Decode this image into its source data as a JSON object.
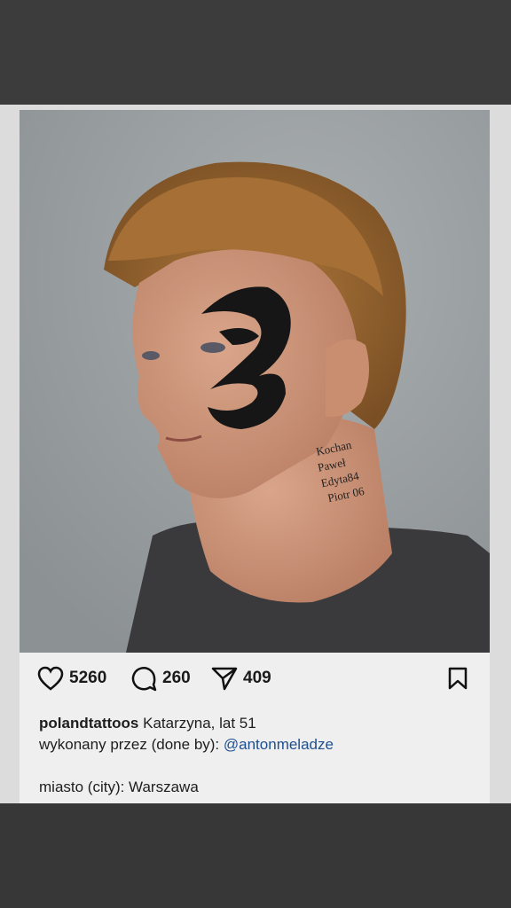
{
  "post": {
    "photo_alt": "portrait-photo",
    "neck_tattoo_lines": [
      "Kochan",
      "Paweł",
      "Edyta84",
      "Piotr 06"
    ],
    "likes": "5260",
    "comments": "260",
    "shares": "409",
    "username": "polandtattoos",
    "caption_line1": "Katarzyna, lat 51",
    "caption_line2": "wykonany przez (done by):",
    "mention": "@antonmeladze",
    "caption_line3": "miasto (city): Warszawa"
  },
  "icons": [
    "heart-icon",
    "comment-icon",
    "share-icon",
    "bookmark-icon"
  ],
  "colors": {
    "mention": "#1f4f8f",
    "text": "#1e1e1e",
    "backdrop": "#3b3b3b"
  }
}
